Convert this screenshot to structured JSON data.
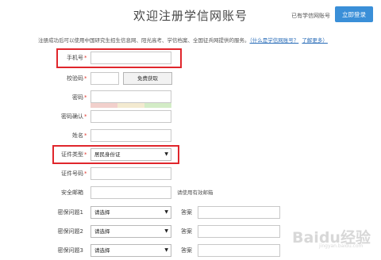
{
  "header": {
    "title": "欢迎注册学信网账号",
    "already_have": "已有学信网账号",
    "login_button": "立即登录"
  },
  "intro": {
    "text": "注册成功后可以使用中国研究生招生信息网、阳光高考、学信档案、全国征兵网提供的服务。",
    "link_what": "（什么是学信网账号？",
    "link_more": "了解更多）"
  },
  "form": {
    "phone_label": "手机号",
    "code_label": "校验码",
    "get_code_button": "免费获取",
    "password_label": "密码",
    "password_confirm_label": "密码确认",
    "name_label": "姓名",
    "id_type_label": "证件类型",
    "id_type_value": "居民身份证",
    "id_number_label": "证件号码",
    "email_label": "安全邮箱",
    "email_hint": "请使用有效邮箱",
    "q1_label": "密保问题1",
    "q2_label": "密保问题2",
    "q3_label": "密保问题3",
    "select_placeholder": "请选择",
    "answer_label": "答案",
    "required_mark": "*"
  },
  "colors": {
    "accent": "#3a8fd8",
    "highlight": "#e0262c",
    "required": "#e0352b",
    "strength": [
      "#f2d0cc",
      "#f3ead0",
      "#d3ecc6"
    ]
  },
  "watermark": {
    "text": "Baidu经验",
    "sub": "jingyan.baidu.com"
  }
}
